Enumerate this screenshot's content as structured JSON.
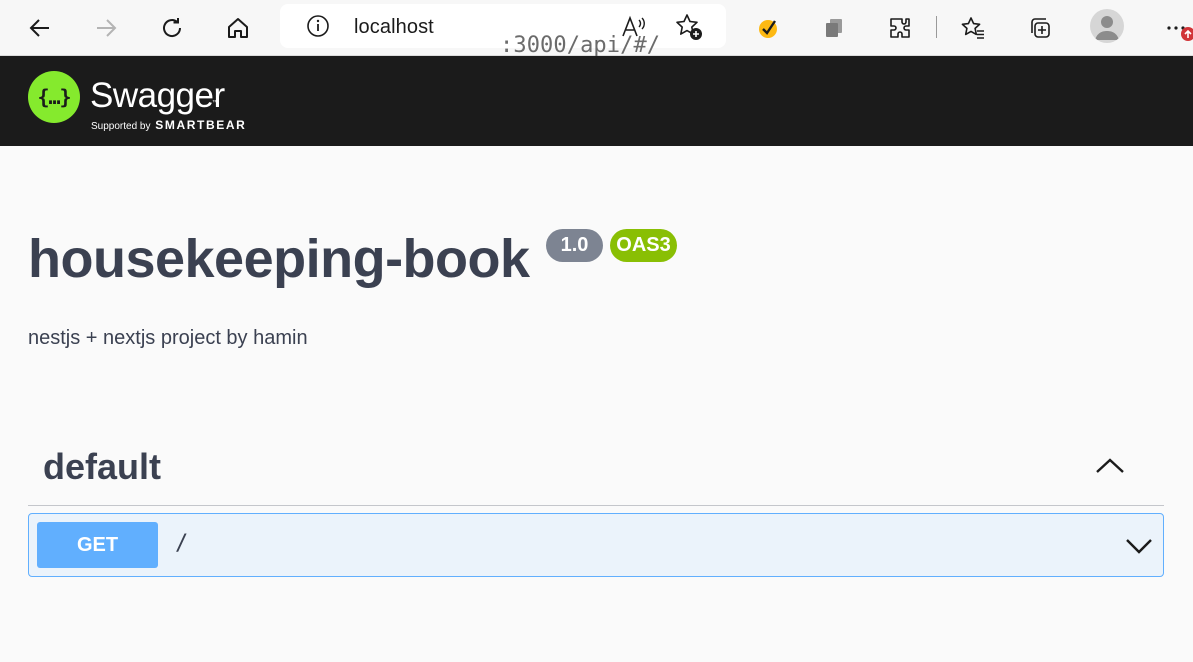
{
  "browser": {
    "url_host": "localhost",
    "url_path": ":3000/api/#/"
  },
  "swagger": {
    "brand": "Swagger",
    "tm": "™",
    "supported_by": "Supported by",
    "smartbear": "SMARTBEAR",
    "logo_glyph": "{…}"
  },
  "info": {
    "title": "housekeeping-book",
    "version": "1.0",
    "oas": "OAS3",
    "description": "nestjs + nextjs project by hamin"
  },
  "tag": {
    "name": "default",
    "expanded": true
  },
  "operations": [
    {
      "method": "GET",
      "path": "/"
    }
  ],
  "colors": {
    "topbar": "#1b1b1b",
    "swagger_green": "#85ea2d",
    "get_blue": "#61affe",
    "oas_green": "#89bf04",
    "version_gray": "#7d8492",
    "text": "#3b4151"
  },
  "icons": [
    "back-icon",
    "forward-icon",
    "refresh-icon",
    "home-icon",
    "info-icon",
    "read-aloud-icon",
    "add-favorite-icon",
    "norton-check-icon",
    "extension-copy-icon",
    "extensions-icon",
    "favorites-icon",
    "collections-icon",
    "profile-icon",
    "more-icon",
    "chevron-up-icon",
    "chevron-down-icon"
  ]
}
